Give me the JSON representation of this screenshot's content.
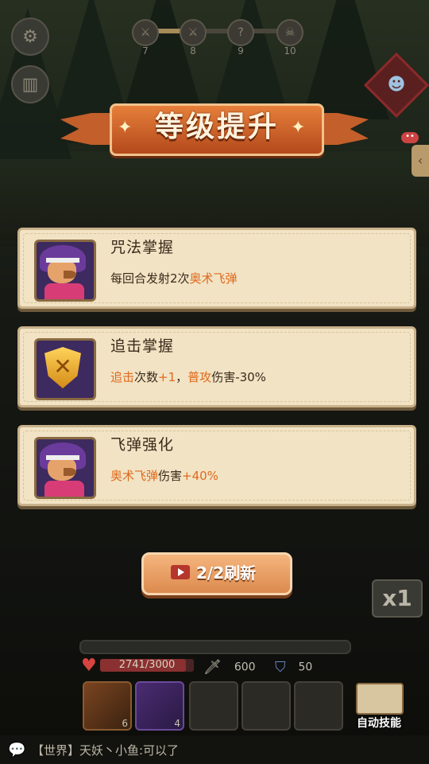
{
  "top": {
    "stages": [
      "7",
      "8",
      "9",
      "10"
    ]
  },
  "banner": {
    "title": "等级提升"
  },
  "cards": [
    {
      "name": "咒法掌握",
      "desc": [
        {
          "t": "每回合发射2次",
          "hl": false
        },
        {
          "t": "奥术飞弹",
          "hl": true
        }
      ]
    },
    {
      "name": "追击掌握",
      "desc": [
        {
          "t": "追击",
          "hl": true
        },
        {
          "t": "次数",
          "hl": false
        },
        {
          "t": "+1",
          "hl": true
        },
        {
          "t": "，",
          "hl": false
        },
        {
          "t": "普攻",
          "hl": true
        },
        {
          "t": "伤害-30%",
          "hl": false
        }
      ]
    },
    {
      "name": "飞弹强化",
      "desc": [
        {
          "t": "奥术飞弹",
          "hl": true
        },
        {
          "t": "伤害",
          "hl": false
        },
        {
          "t": "+40%",
          "hl": true
        }
      ]
    }
  ],
  "refresh": {
    "label": "2/2刷新"
  },
  "speed": {
    "label": "x1"
  },
  "hud": {
    "hp_text": "2741/3000",
    "hp_current": 2741,
    "hp_max": 3000,
    "attack": "600",
    "defense": "50",
    "slots": [
      {
        "type": "gold",
        "count": "6"
      },
      {
        "type": "purple",
        "count": "4"
      },
      {
        "type": "empty",
        "count": ""
      },
      {
        "type": "empty",
        "count": ""
      },
      {
        "type": "empty",
        "count": ""
      }
    ],
    "book_label": "自动技能"
  },
  "chat": {
    "message": "【世界】天妖丶小鱼:可以了"
  },
  "colors": {
    "highlight": "#e0691c",
    "banner": "#c35f2a",
    "card_bg": "#f1e3c4"
  },
  "icons": {
    "settings": "gear-icon",
    "stats": "bar-chart-icon",
    "boss": "boss-portrait-icon",
    "refresh": "video-ad-icon",
    "hp": "heart-icon",
    "attack": "sword-icon",
    "defense": "shield-icon",
    "book": "book-icon",
    "chat": "chat-bubble-icon"
  }
}
